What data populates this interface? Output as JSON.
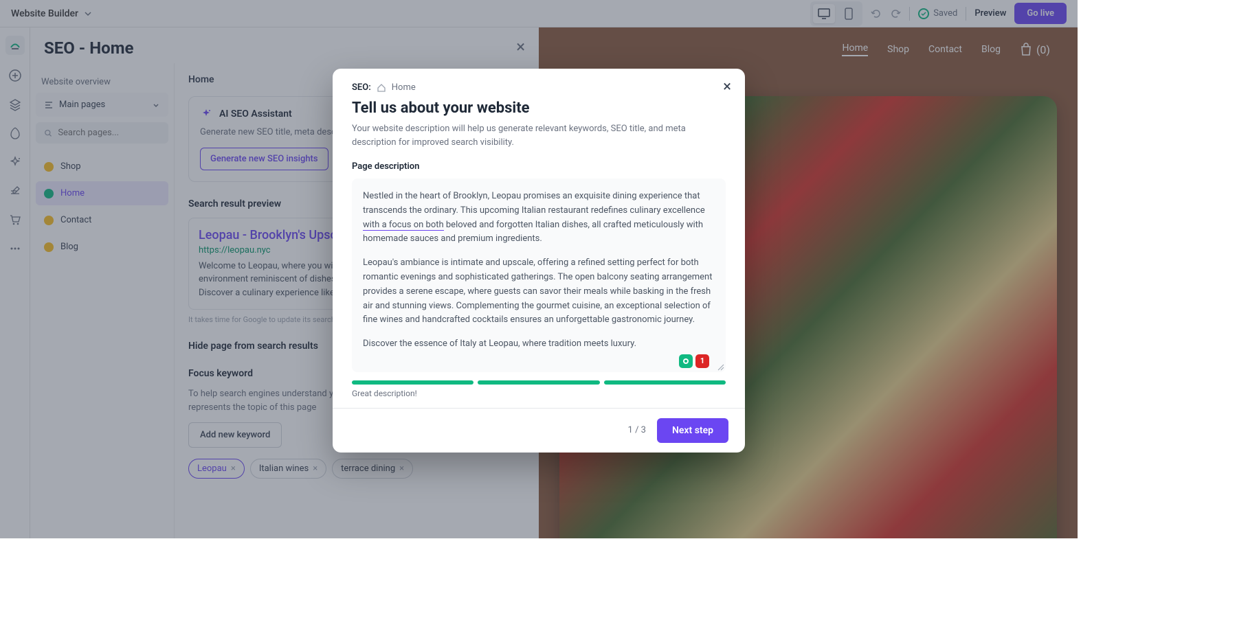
{
  "topbar": {
    "app_name": "Website Builder",
    "saved_label": "Saved",
    "preview_label": "Preview",
    "golive_label": "Go live"
  },
  "seo_panel": {
    "title": "SEO - Home",
    "overview_label": "Website overview",
    "main_pages_label": "Main pages",
    "search_placeholder": "Search pages...",
    "pages": [
      {
        "label": "Shop",
        "status": "warn"
      },
      {
        "label": "Home",
        "status": "ok",
        "active": true
      },
      {
        "label": "Contact",
        "status": "warn"
      },
      {
        "label": "Blog",
        "status": "warn"
      }
    ],
    "content_label": "Home",
    "ai": {
      "title": "AI SEO Assistant",
      "desc": "Generate new SEO title, meta description, and focus keywords for the page",
      "button": "Generate new SEO insights"
    },
    "preview": {
      "section_label": "Search result preview",
      "title": "Leopau - Brooklyn's Upscale Italian",
      "url": "https://leopau.nyc",
      "desc": "Welcome to Leopau, where you will be greeted by a warm and friendly environment reminiscent of dishes and recipes from famous Italian chefs. Discover a culinary experience like no other.",
      "note": "It takes time for Google to update its search results."
    },
    "hide_label": "Hide page from search results",
    "focus": {
      "label": "Focus keyword",
      "help": "To help search engines understand your content, add a keyphrase that best represents the topic of this page",
      "add_button": "Add new keyword",
      "tags": [
        "Leopau",
        "Italian wines",
        "terrace dining"
      ]
    }
  },
  "site": {
    "nav": [
      "Home",
      "Shop",
      "Contact",
      "Blog"
    ],
    "cart_count": "(0)"
  },
  "modal": {
    "crumb_prefix": "SEO:",
    "crumb_page": "Home",
    "title": "Tell us about your website",
    "subtitle": "Your website description will help us generate relevant keywords, SEO title, and meta description for improved search visibility.",
    "field_label": "Page description",
    "desc_p1a": "Nestled in the heart of Brooklyn, Leopau promises an exquisite dining experience that transcends the ordinary. This upcoming Italian restaurant redefines culinary excellence ",
    "desc_p1_u": "with a focus on both",
    "desc_p1b": " beloved and forgotten Italian dishes, all crafted meticulously with homemade sauces and premium ingredients.",
    "desc_p2": "Leopau's ambiance is intimate and upscale, offering a refined setting perfect for both romantic evenings and sophisticated gatherings. The open balcony seating arrangement provides a serene escape, where guests can savor their meals while basking in the fresh air and stunning views. Complementing the gourmet cuisine, an exceptional selection of fine wines and handcrafted cocktails ensures an unforgettable gastronomic journey.",
    "desc_p3": "Discover the essence of Italy at Leopau, where tradition meets luxury.",
    "badge_count": "1",
    "progress_label": "Great description!",
    "step_count": "1 / 3",
    "next_label": "Next step"
  }
}
